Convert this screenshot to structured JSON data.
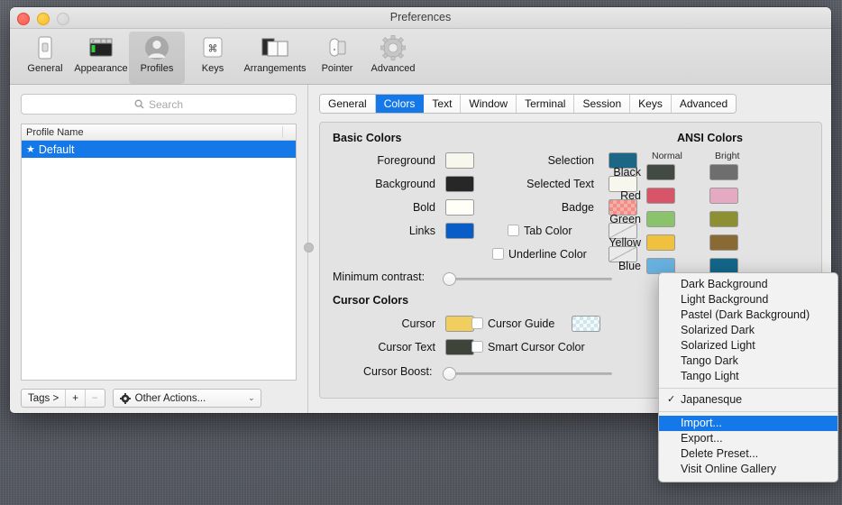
{
  "window": {
    "title": "Preferences",
    "traffic_lights": [
      "close-button",
      "minimize-button",
      "zoom-button"
    ]
  },
  "toolbar": {
    "items": [
      {
        "label": "General",
        "icon": "general-icon",
        "selected": false
      },
      {
        "label": "Appearance",
        "icon": "appearance-icon",
        "selected": false
      },
      {
        "label": "Profiles",
        "icon": "profiles-icon",
        "selected": true
      },
      {
        "label": "Keys",
        "icon": "keys-icon",
        "selected": false
      },
      {
        "label": "Arrangements",
        "icon": "arrangements-icon",
        "selected": false
      },
      {
        "label": "Pointer",
        "icon": "pointer-icon",
        "selected": false
      },
      {
        "label": "Advanced",
        "icon": "advanced-icon",
        "selected": false
      }
    ]
  },
  "sidebar": {
    "search": {
      "placeholder": "Search",
      "value": "",
      "icon": "search-icon"
    },
    "table": {
      "column_header": "Profile Name",
      "rows": [
        {
          "star": "★",
          "name": "Default",
          "selected": true
        }
      ]
    },
    "buttons": {
      "tags_label": "Tags >",
      "add_label": "+",
      "remove_label": "−",
      "other_actions_label": "Other Actions...",
      "other_actions_icon": "gear-icon",
      "chevron": "⌄"
    }
  },
  "tabs": [
    {
      "label": "General",
      "active": false
    },
    {
      "label": "Colors",
      "active": true
    },
    {
      "label": "Text",
      "active": false
    },
    {
      "label": "Window",
      "active": false
    },
    {
      "label": "Terminal",
      "active": false
    },
    {
      "label": "Session",
      "active": false
    },
    {
      "label": "Keys",
      "active": false
    },
    {
      "label": "Advanced",
      "active": false
    }
  ],
  "colors_panel": {
    "basic_colors_title": "Basic Colors",
    "cursor_colors_title": "Cursor Colors",
    "ansi_colors_title": "ANSI Colors",
    "basic_left": [
      {
        "label": "Foreground",
        "color": "#f8f7ee"
      },
      {
        "label": "Background",
        "color": "#272727"
      },
      {
        "label": "Bold",
        "color": "#fffef7"
      },
      {
        "label": "Links",
        "color": "#0a5cc6"
      }
    ],
    "basic_right": [
      {
        "label": "Selection",
        "color": "#1d6786",
        "checkbox": false
      },
      {
        "label": "Selected Text",
        "color": "#f8f7ee",
        "checkbox": false
      },
      {
        "label": "Badge",
        "color": "checker-pink",
        "checkbox": false
      },
      {
        "label": "Tab Color",
        "color": "empty",
        "checkbox": true,
        "checked": false
      },
      {
        "label": "Underline Color",
        "color": "empty",
        "checkbox": true,
        "checked": false
      }
    ],
    "minimum_contrast": {
      "label": "Minimum contrast:",
      "value": 0
    },
    "cursor_left": [
      {
        "label": "Cursor",
        "color": "#f0cf5f"
      },
      {
        "label": "Cursor Text",
        "color": "#3e443a"
      }
    ],
    "cursor_right": [
      {
        "label": "Cursor Guide",
        "color": "checker-blue",
        "checkbox": true,
        "checked": false
      },
      {
        "label": "Smart Cursor Color",
        "color": null,
        "checkbox": true,
        "checked": false
      }
    ],
    "cursor_boost": {
      "label": "Cursor Boost:",
      "value": 0
    },
    "ansi": {
      "col_normal": "Normal",
      "col_bright": "Bright",
      "rows": [
        {
          "label": "Black",
          "normal": "#434a43",
          "bright": "#6e6e6e"
        },
        {
          "label": "Red",
          "normal": "#d85468",
          "bright": "#e4aac2"
        },
        {
          "label": "Green",
          "normal": "#8ac36b",
          "bright": "#8d8f33"
        },
        {
          "label": "Yellow",
          "normal": "#f0c13e",
          "bright": "#8a6a34"
        },
        {
          "label": "Blue",
          "normal": "#68b2e0",
          "bright": "#13678a"
        }
      ]
    }
  },
  "presets_menu": {
    "items": [
      {
        "label": "Dark Background",
        "checked": false,
        "highlight": false
      },
      {
        "label": "Light Background",
        "checked": false,
        "highlight": false
      },
      {
        "label": "Pastel (Dark Background)",
        "checked": false,
        "highlight": false
      },
      {
        "label": "Solarized Dark",
        "checked": false,
        "highlight": false
      },
      {
        "label": "Solarized Light",
        "checked": false,
        "highlight": false
      },
      {
        "label": "Tango Dark",
        "checked": false,
        "highlight": false
      },
      {
        "label": "Tango Light",
        "checked": false,
        "highlight": false
      },
      {
        "separator": true
      },
      {
        "label": "Japanesque",
        "checked": true,
        "check_glyph": "✓",
        "highlight": false
      },
      {
        "separator": true
      },
      {
        "label": "Import...",
        "checked": false,
        "highlight": true
      },
      {
        "label": "Export...",
        "checked": false,
        "highlight": false
      },
      {
        "label": "Delete Preset...",
        "checked": false,
        "highlight": false
      },
      {
        "label": "Visit Online Gallery",
        "checked": false,
        "highlight": false
      }
    ]
  }
}
